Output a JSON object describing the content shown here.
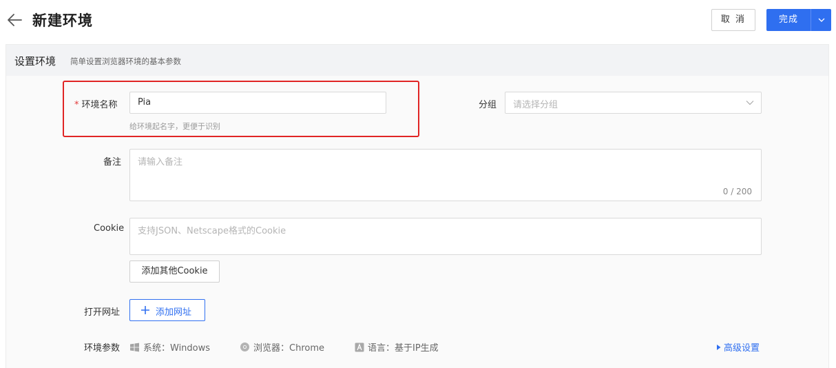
{
  "header": {
    "title": "新建环境",
    "cancel_label": "取 消",
    "done_label": "完成"
  },
  "section": {
    "title": "设置环境",
    "subtitle": "简单设置浏览器环境的基本参数"
  },
  "form": {
    "name": {
      "required_mark": "*",
      "label": "环境名称",
      "value": "Pia",
      "hint": "给环境起名字，更便于识别"
    },
    "group": {
      "label": "分组",
      "placeholder": "请选择分组"
    },
    "note": {
      "label": "备注",
      "placeholder": "请输入备注",
      "counter": "0 / 200"
    },
    "cookie": {
      "label": "Cookie",
      "placeholder": "支持JSON、Netscape格式的Cookie",
      "add_button": "添加其他Cookie"
    },
    "open_url": {
      "label": "打开网址",
      "add_button": "添加网址"
    },
    "env_params": {
      "label": "环境参数",
      "system": "系统：Windows",
      "browser": "浏览器：Chrome",
      "language": "语言：基于IP生成",
      "advanced": "高级设置"
    }
  },
  "colors": {
    "primary": "#2f6ff0",
    "required": "#e23b3b",
    "highlight_border": "#e02424"
  }
}
